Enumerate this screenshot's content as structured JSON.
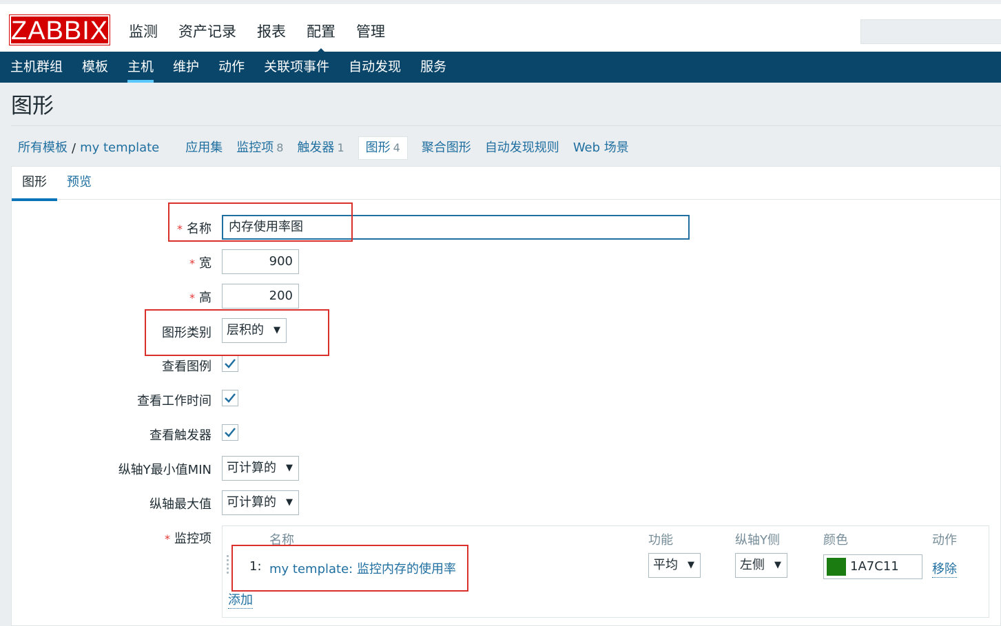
{
  "header": {
    "logo": "ZABBIX",
    "main_menu": [
      "监测",
      "资产记录",
      "报表",
      "配置",
      "管理"
    ],
    "main_menu_active": "配置"
  },
  "sub_menu": [
    "主机群组",
    "模板",
    "主机",
    "维护",
    "动作",
    "关联项事件",
    "自动发现",
    "服务"
  ],
  "sub_menu_active": "主机",
  "page_title": "图形",
  "breadcrumbs": {
    "all_templates": "所有模板",
    "separator": "/",
    "template": "my template",
    "tabs": [
      {
        "label": "应用集",
        "count": ""
      },
      {
        "label": "监控项",
        "count": "8"
      },
      {
        "label": "触发器",
        "count": "1"
      },
      {
        "label": "图形",
        "count": "4"
      },
      {
        "label": "聚合图形",
        "count": ""
      },
      {
        "label": "自动发现规则",
        "count": ""
      },
      {
        "label": "Web 场景",
        "count": ""
      }
    ]
  },
  "inner_tabs": [
    "图形",
    "预览"
  ],
  "form": {
    "required_mark": "*",
    "name_label": "名称",
    "name_value": "内存使用率图",
    "width_label": "宽",
    "width_value": "900",
    "height_label": "高",
    "height_value": "200",
    "graph_type_label": "图形类别",
    "graph_type_value": "层积的",
    "show_legend_label": "查看图例",
    "show_legend": true,
    "show_working_time_label": "查看工作时间",
    "show_working_time": true,
    "show_triggers_label": "查看触发器",
    "show_triggers": true,
    "ymin_label": "纵轴Y最小值MIN",
    "ymin_value": "可计算的",
    "ymax_label": "纵轴最大值",
    "ymax_value": "可计算的",
    "items_label": "监控项"
  },
  "items_table": {
    "columns": [
      "名称",
      "功能",
      "纵轴Y侧",
      "颜色",
      "动作"
    ],
    "rows": [
      {
        "index": "1:",
        "name": "my template: 监控内存的使用率",
        "function": "平均",
        "yaxis_side": "左侧",
        "color": "1A7C11",
        "action": "移除"
      }
    ],
    "add_label": "添加"
  },
  "colors": {
    "brand_red": "#d40000",
    "nav_blue": "#0a466a",
    "link": "#1f6fa0",
    "item_color": "#1A7C11",
    "annotation_red": "#d9302b"
  },
  "icons": [
    "dropdown-arrow-icon",
    "checkmark-icon",
    "drag-handle-icon"
  ]
}
